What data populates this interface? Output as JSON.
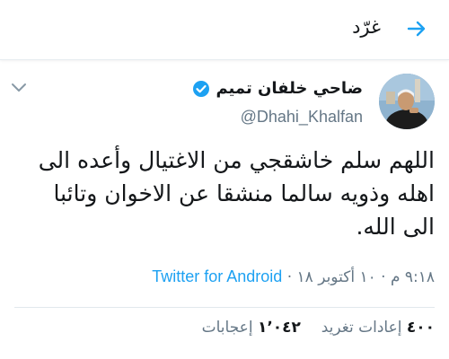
{
  "header": {
    "title": "غرّد",
    "back_icon": "arrow-right-icon"
  },
  "tweet": {
    "author_name": "ضاحي خلفان تميم",
    "author_handle": "@Dhahi_Khalfan",
    "verified": true,
    "text": "اللهم سلم خاشقجي من الاغتيال  وأعده الى اهله وذويه سالما منشقا عن الاخوان وتائبا الى الله.",
    "time": "٩:١٨ م",
    "date": "١٠ أكتوبر ١٨",
    "separator": "·",
    "source": "Twitter for Android",
    "retweets_count": "٤٠٠",
    "retweets_label": "إعادات تغريد",
    "likes_count": "١٬٠٤٢",
    "likes_label": "إعجابات"
  },
  "colors": {
    "accent": "#1da1f2",
    "verified": "#1da1f2",
    "muted": "#657786",
    "text": "#14171a"
  }
}
